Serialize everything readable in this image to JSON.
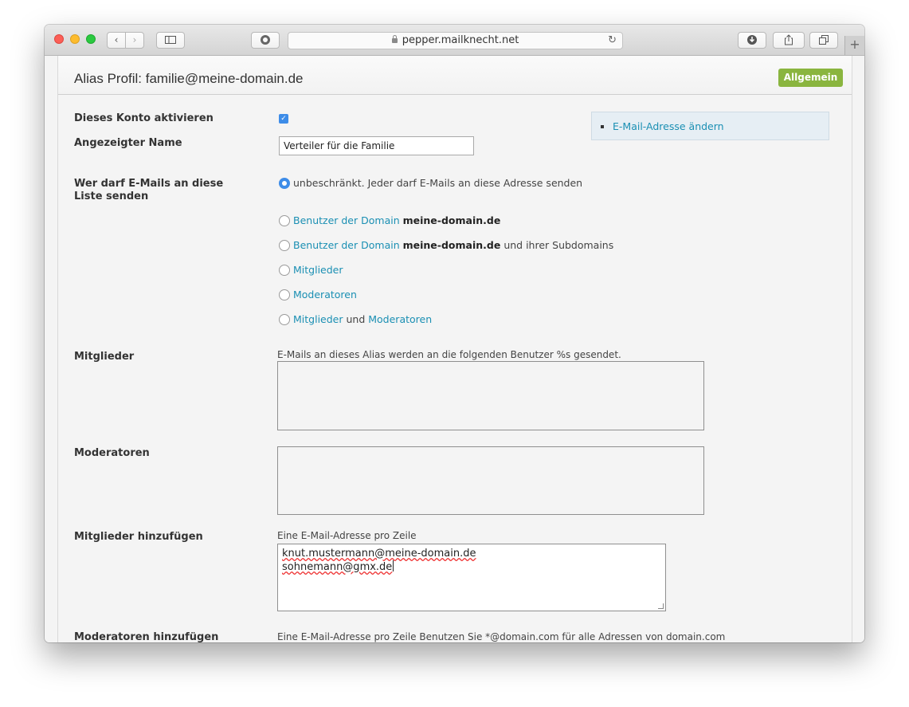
{
  "browser": {
    "url": "pepper.mailknecht.net",
    "newtab_symbol": "+"
  },
  "header": {
    "title": "Alias Profil: familie@meine-domain.de",
    "general_button": "Allgemein"
  },
  "form": {
    "activate_label": "Dieses Konto aktivieren",
    "activate_checked": true,
    "display_name_label": "Angezeigter Name",
    "display_name_value": "Verteiler für die Familie",
    "who_can_send_label": "Wer darf E-Mails an diese Liste senden",
    "options": {
      "unrestricted": "unbeschränkt. Jeder darf E-Mails an diese Adresse senden",
      "domain_users_link": "Benutzer der Domain",
      "domain_name": "meine-domain.de",
      "subdomains_suffix": "und ihrer Subdomains",
      "members": "Mitglieder",
      "moderators": "Moderatoren",
      "and": "und"
    },
    "members_label": "Mitglieder",
    "members_hint": "E-Mails an dieses Alias werden an die folgenden Benutzer %s gesendet.",
    "moderators_label": "Moderatoren",
    "add_members_label": "Mitglieder hinzufügen",
    "add_members_hint": "Eine E-Mail-Adresse pro Zeile",
    "add_members_lines": [
      "knut.mustermann@meine-domain.de",
      "sohnemann@gmx.de"
    ],
    "add_moderators_label": "Moderatoren hinzufügen",
    "add_moderators_hint": "Eine E-Mail-Adresse pro Zeile Benutzen Sie *@domain.com für alle Adressen von domain.com"
  },
  "sidebar": {
    "change_email_link": "E-Mail-Adresse ändern"
  }
}
